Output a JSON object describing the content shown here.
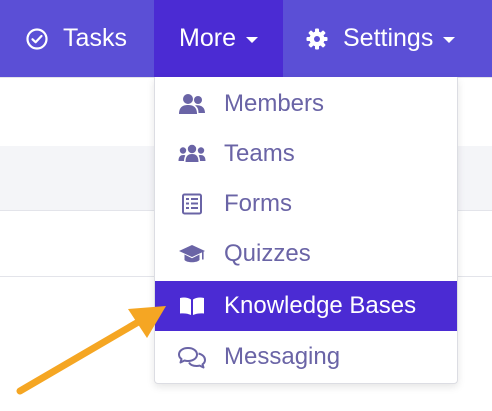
{
  "nav": {
    "tasks_label": "Tasks",
    "more_label": "More",
    "settings_label": "Settings"
  },
  "menu": {
    "items": [
      {
        "label": "Members",
        "icon": "members-icon"
      },
      {
        "label": "Teams",
        "icon": "teams-icon"
      },
      {
        "label": "Forms",
        "icon": "forms-icon"
      },
      {
        "label": "Quizzes",
        "icon": "quizzes-icon"
      },
      {
        "label": "Knowledge Bases",
        "icon": "book-icon",
        "selected": true
      },
      {
        "label": "Messaging",
        "icon": "messaging-icon"
      }
    ]
  },
  "colors": {
    "nav_bg": "#5b4fd6",
    "nav_active": "#4b2bd3",
    "menu_text": "#6a64a6",
    "selected_bg": "#4b2bd3",
    "annotation_arrow": "#f5a623"
  }
}
